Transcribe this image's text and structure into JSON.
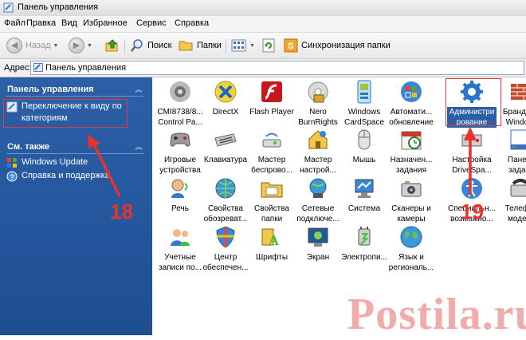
{
  "window": {
    "title": "Панель управления"
  },
  "menu": [
    "Файл",
    "Правка",
    "Вид",
    "Избранное",
    "Сервис",
    "Справка"
  ],
  "toolbar": {
    "back": "Назад",
    "search": "Поиск",
    "folders": "Папки",
    "sync": "Синхронизация папки"
  },
  "address": {
    "label": "Адрес:",
    "value": "Панель управления"
  },
  "sidebar": {
    "panel_title": "Панель управления",
    "switch_view": [
      "Переключение к виду по",
      "категориям"
    ],
    "see_also_title": "См. также",
    "see_also": [
      "Windows Update",
      "Справка и поддержка"
    ]
  },
  "items": [
    [
      "CMI8738/8...",
      "Control Pa..."
    ],
    [
      "DirectX"
    ],
    [
      "Flash Player"
    ],
    [
      "Nero",
      "BurnRights"
    ],
    [
      "Windows",
      "CardSpace"
    ],
    [
      "Автомати...",
      "обновление"
    ],
    [
      "Администри",
      "рование"
    ],
    [
      "Брандм...",
      "Windo..."
    ],
    [
      "Игровые",
      "устройства"
    ],
    [
      "Клавиатура"
    ],
    [
      "Мастер",
      "беспрово..."
    ],
    [
      "Мастер",
      "настрой..."
    ],
    [
      "Мышь"
    ],
    [
      "Назначен...",
      "задания"
    ],
    [
      "Настройка",
      "DriveSpa..."
    ],
    [
      "Пане...",
      "зада..."
    ],
    [
      "Речь"
    ],
    [
      "Свойства",
      "обозреват..."
    ],
    [
      "Свойства",
      "папки"
    ],
    [
      "Сетевые",
      "подключе..."
    ],
    [
      "Система"
    ],
    [
      "Сканеры и",
      "камеры"
    ],
    [
      "Специальн...",
      "возможно..."
    ],
    [
      "Телеф...",
      "моде..."
    ],
    [
      "Учетные",
      "записи по..."
    ],
    [
      "Центр",
      "обеспечен..."
    ],
    [
      "Шрифты"
    ],
    [
      "Экран"
    ],
    [
      "Электропи..."
    ],
    [
      "Язык и",
      "региональ..."
    ]
  ],
  "annotations": {
    "left_number": "18",
    "right_number": "19"
  },
  "watermark": "Postila.ru",
  "colors": {
    "sidebar": "#25579e",
    "selection": "#2b5fa8",
    "annotation": "#e8332c"
  }
}
